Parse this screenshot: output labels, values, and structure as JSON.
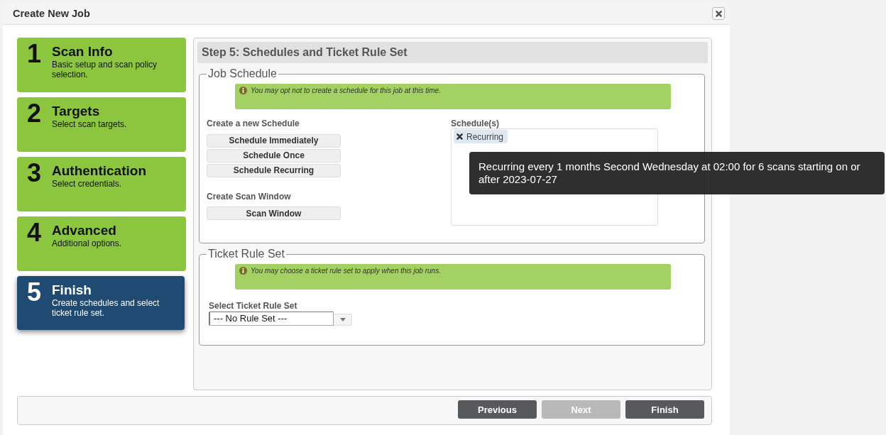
{
  "window": {
    "title": "Create New Job"
  },
  "steps": [
    {
      "number": "1",
      "title": "Scan Info",
      "description": "Basic setup and scan policy selection.",
      "selected": false
    },
    {
      "number": "2",
      "title": "Targets",
      "description": "Select scan targets.",
      "selected": false
    },
    {
      "number": "3",
      "title": "Authentication",
      "description": "Select credentials.",
      "selected": false
    },
    {
      "number": "4",
      "title": "Advanced",
      "description": "Additional options.",
      "selected": false
    },
    {
      "number": "5",
      "title": "Finish",
      "description": "Create schedules and select ticket rule set.",
      "selected": true
    }
  ],
  "panel": {
    "heading": "Step 5: Schedules and Ticket Rule Set"
  },
  "job_schedule": {
    "legend": "Job Schedule",
    "notice": "You may opt not to create a schedule for this job at this time.",
    "create_label": "Create a new Schedule",
    "create_buttons": [
      "Schedule Immediately",
      "Schedule Once",
      "Schedule Recurring"
    ],
    "window_label": "Create Scan Window",
    "window_buttons": [
      "Scan Window"
    ],
    "schedules_label": "Schedule(s)",
    "schedules": [
      {
        "label": "Recurring",
        "tooltip": "Recurring every 1 months Second Wednesday at 02:00 for 6 scans starting on or after 2023-07-27"
      }
    ]
  },
  "ticket_rule_set": {
    "legend": "Ticket Rule Set",
    "notice": "You may choose a ticket rule set to apply when this job runs.",
    "select_label": "Select Ticket Rule Set",
    "select_value": "--- No Rule Set ---"
  },
  "footer": {
    "buttons": [
      {
        "label": "Previous",
        "disabled": false
      },
      {
        "label": "Next",
        "disabled": true
      },
      {
        "label": "Finish",
        "disabled": false
      }
    ]
  }
}
